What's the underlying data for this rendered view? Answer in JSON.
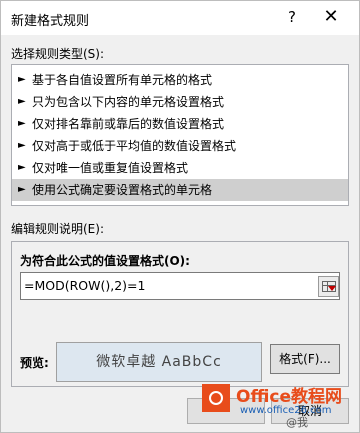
{
  "dialog": {
    "title": "新建格式规则",
    "help_glyph": "?",
    "close_glyph": "✕"
  },
  "rule_type": {
    "label": "选择规则类型(S):",
    "items": [
      {
        "arrow": "►",
        "label": "基于各自值设置所有单元格的格式"
      },
      {
        "arrow": "►",
        "label": "只为包含以下内容的单元格设置格式"
      },
      {
        "arrow": "►",
        "label": "仅对排名靠前或靠后的数值设置格式"
      },
      {
        "arrow": "►",
        "label": "仅对高于或低于平均值的数值设置格式"
      },
      {
        "arrow": "►",
        "label": "仅对唯一值或重复值设置格式"
      },
      {
        "arrow": "►",
        "label": "使用公式确定要设置格式的单元格"
      }
    ],
    "selected_index": 5
  },
  "edit": {
    "label": "编辑规则说明(E):",
    "formula_label": "为符合此公式的值设置格式(O):",
    "formula_value": "=MOD(ROW(),2)=1",
    "preview_label": "预览:",
    "preview_text": "微软卓越  AaBbCc",
    "format_button": "格式(F)..."
  },
  "buttons": {
    "cancel": "取消"
  },
  "watermark": {
    "site": "Office教程网",
    "url": "www.office26.com",
    "handle": "@我"
  },
  "colors": {
    "selected_row": "#cfcfcf",
    "preview_bg": "#dde7f0",
    "watermark_orange": "#e84c1b"
  }
}
